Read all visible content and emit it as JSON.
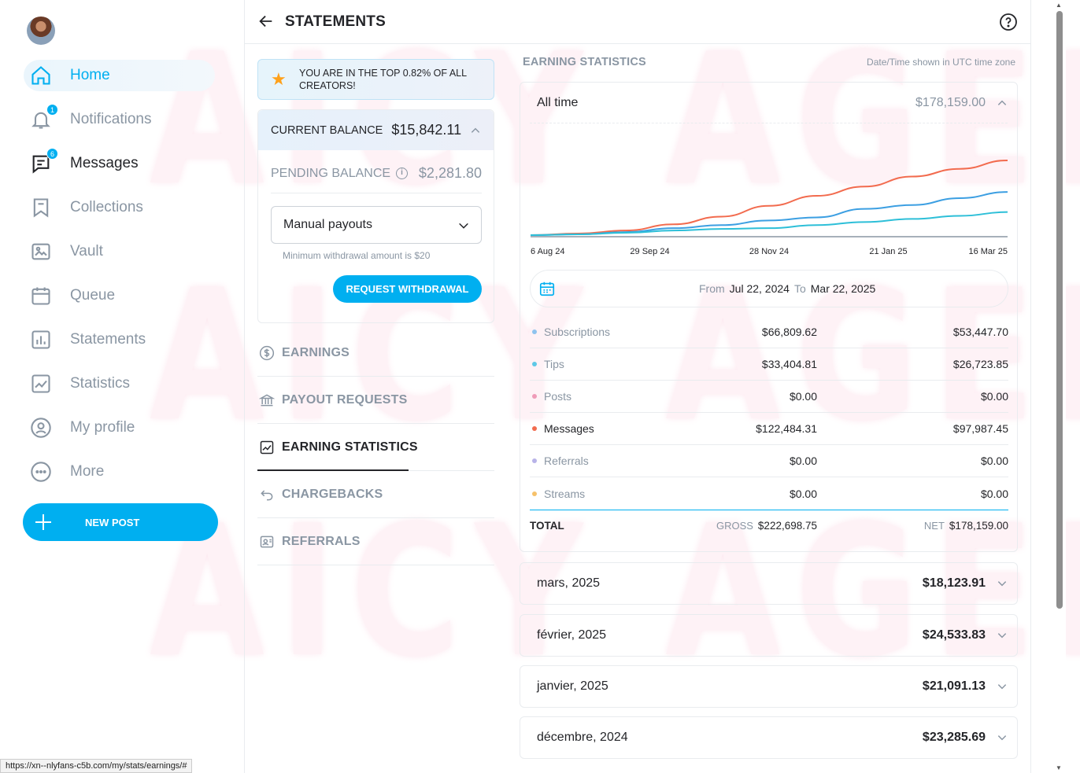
{
  "watermark": {
    "lines": [
      "AICY AGENCY",
      "AICY AGENCY",
      "AICY AGENCY"
    ]
  },
  "sidebar": {
    "items": [
      {
        "label": "Home",
        "icon": "home-icon"
      },
      {
        "label": "Notifications",
        "icon": "bell-icon",
        "badge": "1"
      },
      {
        "label": "Messages",
        "icon": "message-icon",
        "badge": "6"
      },
      {
        "label": "Collections",
        "icon": "collections-icon"
      },
      {
        "label": "Vault",
        "icon": "vault-icon"
      },
      {
        "label": "Queue",
        "icon": "calendar-icon"
      },
      {
        "label": "Statements",
        "icon": "bar-chart-icon"
      },
      {
        "label": "Statistics",
        "icon": "line-chart-icon"
      },
      {
        "label": "My profile",
        "icon": "profile-icon"
      },
      {
        "label": "More",
        "icon": "more-icon"
      }
    ],
    "new_post": "NEW POST"
  },
  "status_url": "https://xn--nlyfans-c5b.com/my/stats/earnings/#",
  "header": {
    "title": "STATEMENTS"
  },
  "banner": {
    "text": "YOU ARE IN THE TOP 0.82% OF ALL CREATORS!"
  },
  "balance": {
    "current_label": "CURRENT BALANCE",
    "current_value": "$15,842.11",
    "pending_label": "PENDING BALANCE",
    "pending_value": "$2,281.80",
    "payout_select": "Manual payouts",
    "hint": "Minimum withdrawal amount is $20",
    "request_button": "REQUEST WITHDRAWAL"
  },
  "menu": [
    {
      "label": "EARNINGS",
      "icon": "dollar-circle-icon"
    },
    {
      "label": "PAYOUT REQUESTS",
      "icon": "bank-icon"
    },
    {
      "label": "EARNING STATISTICS",
      "icon": "trend-icon",
      "active": true
    },
    {
      "label": "CHARGEBACKS",
      "icon": "undo-icon"
    },
    {
      "label": "REFERRALS",
      "icon": "referral-icon"
    }
  ],
  "earning_stats": {
    "title": "EARNING STATISTICS",
    "timezone_note": "Date/Time shown in UTC time zone",
    "period_label": "All time",
    "period_total": "$178,159.00",
    "date_from_label": "From",
    "date_from": "Jul 22, 2024",
    "date_to_label": "To",
    "date_to": "Mar 22, 2025",
    "rows": [
      {
        "name": "Subscriptions",
        "gross": "$66,809.62",
        "net": "$53,447.70",
        "color": "#8fc3ee"
      },
      {
        "name": "Tips",
        "gross": "$33,404.81",
        "net": "$26,723.85",
        "color": "#5ec8e6"
      },
      {
        "name": "Posts",
        "gross": "$0.00",
        "net": "$0.00",
        "color": "#ef9bb8"
      },
      {
        "name": "Messages",
        "gross": "$122,484.31",
        "net": "$97,987.45",
        "color": "#f26b4e"
      },
      {
        "name": "Referrals",
        "gross": "$0.00",
        "net": "$0.00",
        "color": "#b8b3e8"
      },
      {
        "name": "Streams",
        "gross": "$0.00",
        "net": "$0.00",
        "color": "#f6c16a"
      }
    ],
    "total": {
      "label": "TOTAL",
      "gross_label": "GROSS",
      "gross": "$222,698.75",
      "net_label": "NET",
      "net": "$178,159.00"
    }
  },
  "months": [
    {
      "label": "mars, 2025",
      "value": "$18,123.91"
    },
    {
      "label": "février, 2025",
      "value": "$24,533.83"
    },
    {
      "label": "janvier, 2025",
      "value": "$21,091.13"
    },
    {
      "label": "décembre, 2024",
      "value": "$23,285.69"
    }
  ],
  "chart_data": {
    "type": "line",
    "x_tick_labels": [
      "6 Aug 24",
      "29 Sep 24",
      "28 Nov 24",
      "21 Jan 25",
      "16 Mar 25"
    ],
    "x": [
      "2024-07-22",
      "2024-08-15",
      "2024-09-10",
      "2024-10-05",
      "2024-10-30",
      "2024-11-25",
      "2024-12-20",
      "2025-01-15",
      "2025-02-10",
      "2025-03-05",
      "2025-03-22"
    ],
    "series": [
      {
        "color": "#f26b4e",
        "values": [
          0,
          0.02,
          0.06,
          0.14,
          0.24,
          0.38,
          0.51,
          0.63,
          0.76,
          0.86,
          0.97
        ]
      },
      {
        "color": "#3c9fe2",
        "values": [
          0,
          0.01,
          0.04,
          0.09,
          0.13,
          0.19,
          0.23,
          0.34,
          0.39,
          0.48,
          0.56
        ]
      },
      {
        "color": "#2dbfd8",
        "values": [
          0,
          0.01,
          0.03,
          0.06,
          0.08,
          0.09,
          0.13,
          0.17,
          0.21,
          0.25,
          0.3
        ]
      }
    ],
    "grid": false
  }
}
